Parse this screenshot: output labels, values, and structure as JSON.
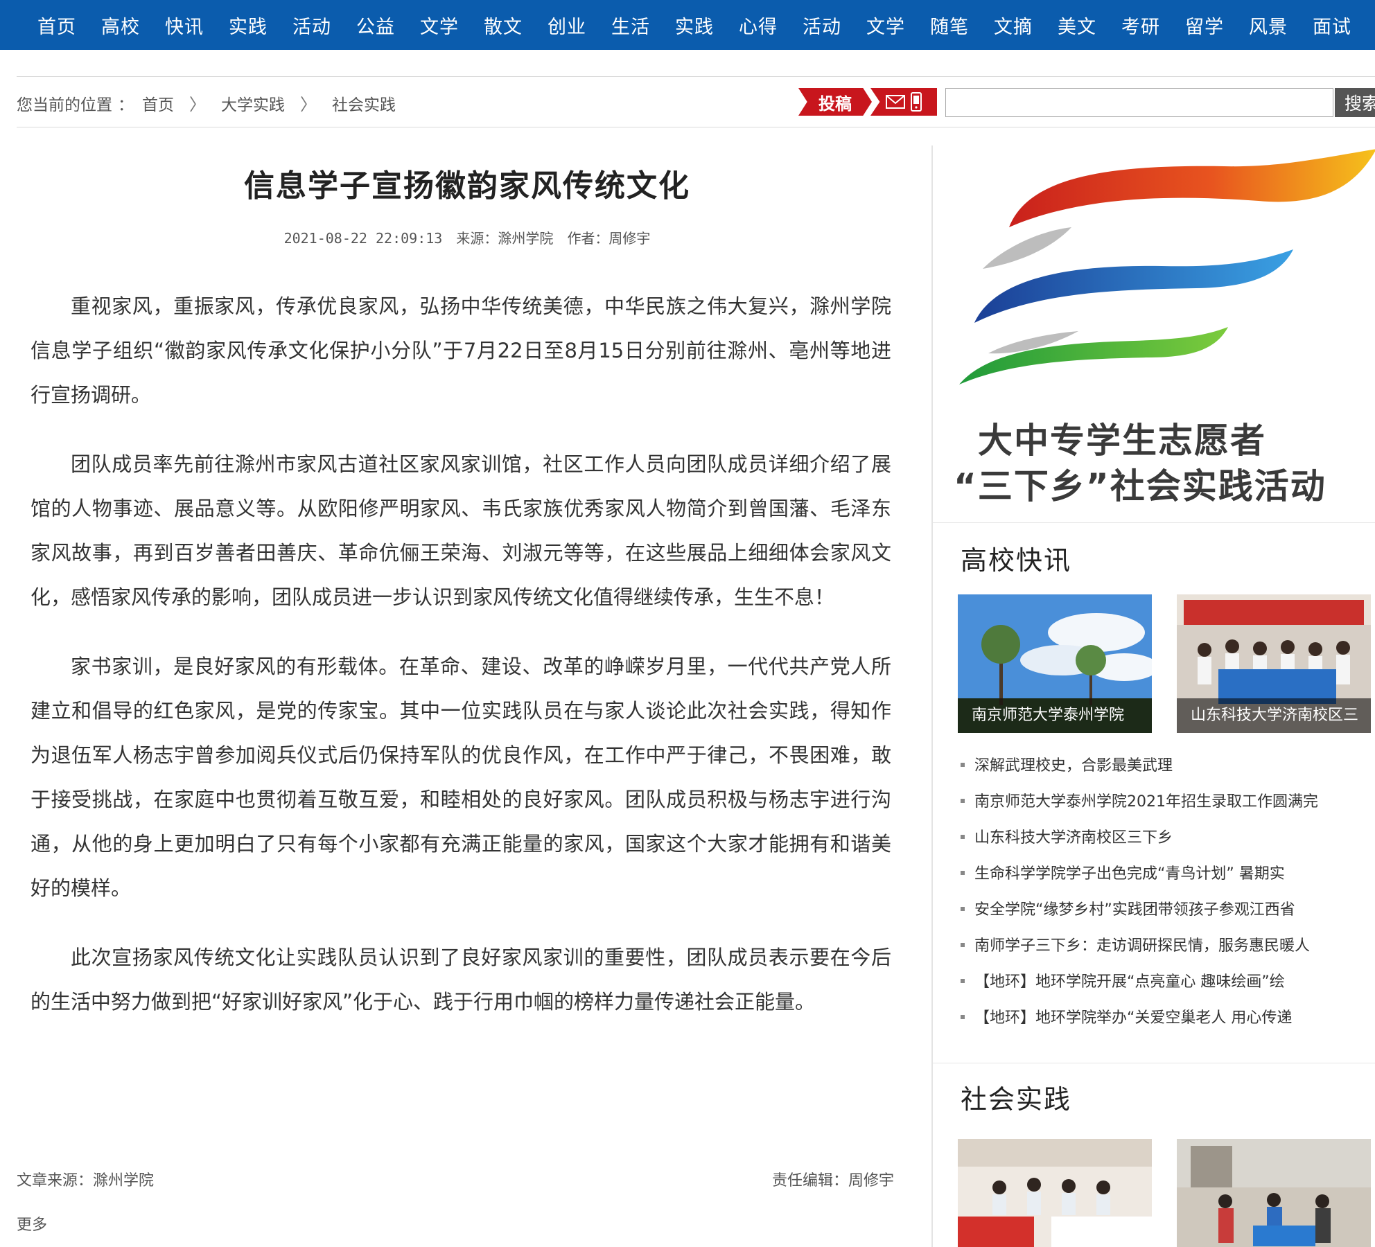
{
  "nav": {
    "items": [
      "首页",
      "高校",
      "快讯",
      "实践",
      "活动",
      "公益",
      "文学",
      "散文",
      "创业",
      "生活",
      "实践",
      "心得",
      "活动",
      "文学",
      "随笔",
      "文摘",
      "美文",
      "考研",
      "留学",
      "风景",
      "面试"
    ]
  },
  "breadcrumb": {
    "prefix": "您当前的位置",
    "colon": "：",
    "items": [
      "首页",
      "大学实践",
      "社会实践"
    ],
    "separator": "〉"
  },
  "toolbar": {
    "submit_label": "投稿",
    "search_placeholder": "",
    "search_label": "搜索"
  },
  "article": {
    "title": "信息学子宣扬徽韵家风传统文化",
    "date": "2021-08-22 22:09:13",
    "source_label": "来源：滁州学院",
    "author_label": "作者：周修宇",
    "paragraphs": [
      "重视家风，重振家风，传承优良家风，弘扬中华传统美德，中华民族之伟大复兴，滁州学院信息学子组织“徽韵家风传承文化保护小分队”于7月22日至8月15日分别前往滁州、亳州等地进行宣扬调研。",
      "团队成员率先前往滁州市家风古道社区家风家训馆，社区工作人员向团队成员详细介绍了展馆的人物事迹、展品意义等。从欧阳修严明家风、韦氏家族优秀家风人物简介到曾国藩、毛泽东家风故事，再到百岁善者田善庆、革命伉俪王荣海、刘淑元等等，在这些展品上细细体会家风文化，感悟家风传承的影响，团队成员进一步认识到家风传统文化值得继续传承，生生不息！",
      "家书家训，是良好家风的有形载体。在革命、建设、改革的峥嵘岁月里，一代代共产党人所建立和倡导的红色家风，是党的传家宝。其中一位实践队员在与家人谈论此次社会实践，得知作为退伍军人杨志宇曾参加阅兵仪式后仍保持军队的优良作风，在工作中严于律己，不畏困难，敢于接受挑战，在家庭中也贯彻着互敬互爱，和睦相处的良好家风。团队成员积极与杨志宇进行沟通，从他的身上更加明白了只有每个小家都有充满正能量的家风，国家这个大家才能拥有和谐美好的模样。",
      "此次宣扬家风传统文化让实践队员认识到了良好家风家训的重要性，团队成员表示要在今后的生活中努力做到把“好家训好家风”化于心、践于行用巾帼的榜样力量传递社会正能量。"
    ],
    "footer_source": "文章来源：滁州学院",
    "footer_editor": "责任编辑：周修宇",
    "more_label": "更多"
  },
  "sidebar": {
    "banner": {
      "line1": "大中专学生志愿者",
      "line2": "“三下乡”社会实践活动",
      "colors": [
        "#d7261e",
        "#f0a21c",
        "#1d4fa3",
        "#2aa84a",
        "#bdbdbd"
      ]
    },
    "news_section": {
      "title": "高校快讯",
      "thumbs": [
        {
          "caption": "南京师范大学泰州学院"
        },
        {
          "caption": "山东科技大学济南校区三"
        }
      ],
      "items": [
        "深解武理校史，合影最美武理",
        "南京师范大学泰州学院2021年招生录取工作圆满完",
        "山东科技大学济南校区三下乡",
        "生命科学学院学子出色完成“青鸟计划” 暑期实",
        "安全学院“缘梦乡村”实践团带领孩子参观江西省",
        "南师学子三下乡：走访调研探民情，服务惠民暖人",
        "【地环】地环学院开展“点亮童心 趣味绘画”绘",
        "【地环】地环学院举办“关爱空巢老人 用心传递"
      ]
    },
    "practice_section": {
      "title": "社会实践"
    }
  },
  "colors": {
    "nav_bg": "#0b5cad",
    "accent_red": "#c8161d",
    "search_btn": "#555555"
  }
}
